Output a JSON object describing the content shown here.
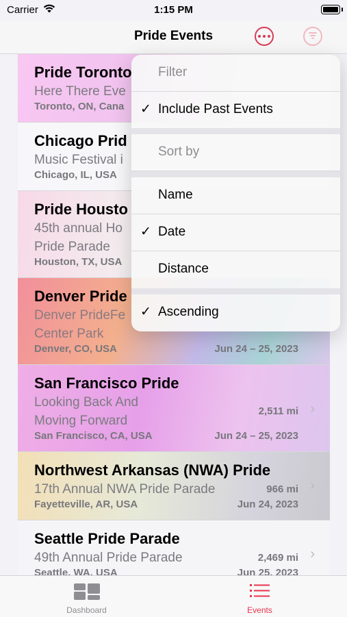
{
  "status_bar": {
    "carrier": "Carrier",
    "time": "1:15 PM"
  },
  "nav": {
    "title": "Pride Events",
    "more_icon": "ellipsis-circle-icon",
    "filter_icon": "filter-circle-icon"
  },
  "events": [
    {
      "name": "Pride Toronto",
      "subtitle": [
        "Here There Eve"
      ],
      "location": "Toronto, ON, Cana",
      "distance": "",
      "date": ""
    },
    {
      "name": "Chicago Prid",
      "subtitle": [
        "Music Festival i"
      ],
      "location": "Chicago, IL, USA",
      "distance": "",
      "date": ""
    },
    {
      "name": "Pride Housto",
      "subtitle": [
        "45th annual Ho",
        "Pride Parade"
      ],
      "location": "Houston, TX, USA",
      "distance": "",
      "date": ""
    },
    {
      "name": "Denver Pride",
      "subtitle": [
        "Denver PrideFe",
        "Center Park"
      ],
      "location": "Denver, CO, USA",
      "distance": "",
      "date": "Jun 24 – 25, 2023"
    },
    {
      "name": "San Francisco Pride",
      "subtitle": [
        "Looking Back And",
        "Moving Forward"
      ],
      "location": "San Francisco, CA, USA",
      "distance": "2,511 mi",
      "date": "Jun 24 – 25, 2023"
    },
    {
      "name": "Northwest Arkansas (NWA) Pride",
      "subtitle": [
        "17th Annual NWA Pride Parade"
      ],
      "location": "Fayetteville, AR, USA",
      "distance": "966 mi",
      "date": "Jun 24, 2023"
    },
    {
      "name": "Seattle Pride Parade",
      "subtitle": [
        "49th Annual Pride Parade"
      ],
      "location": "Seattle, WA, USA",
      "distance": "2,469 mi",
      "date": "Jun 25, 2023"
    }
  ],
  "menu": {
    "filter_header": "Filter",
    "include_past": "Include Past Events",
    "sort_header": "Sort by",
    "name": "Name",
    "date": "Date",
    "distance": "Distance",
    "ascending": "Ascending",
    "checkmark": "✓"
  },
  "tabs": [
    {
      "label": "Dashboard",
      "icon": "dashboard-icon",
      "selected": false
    },
    {
      "label": "Events",
      "icon": "list-icon",
      "selected": true
    }
  ],
  "colors": {
    "accent": "#e8334f",
    "inactive": "#8e8e93"
  }
}
